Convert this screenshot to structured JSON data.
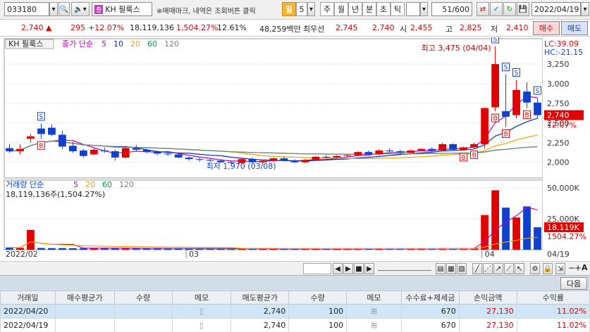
{
  "toolbar": {
    "code": "033180",
    "stock_name": "KH 필룩스",
    "notice": "※매매마크, 내역은 조회버튼 클릭",
    "period_selected": "일",
    "period_num": "5",
    "periods": [
      "주",
      "월",
      "년",
      "분",
      "초",
      "틱"
    ],
    "count": "51/600",
    "date": "2022/04/19"
  },
  "quote": {
    "price": "2,740",
    "change": "295",
    "change_pct": "+12.07%",
    "volume": "18,119,136",
    "volume_pct": "1,504.27%",
    "turnover": "12.61%",
    "amount": "48,259백만",
    "best_ask_label": "최우선",
    "best_ask": "2,745",
    "best_bid": "2,740",
    "open_label": "시",
    "open": "2,455",
    "high_label": "고",
    "high": "2,825",
    "low_label": "저",
    "low": "2,410",
    "sell_label": "매수",
    "buy_label": "매도"
  },
  "chart_data": [
    {
      "type": "candlestick",
      "name": "KH 필룩스",
      "legend": {
        "label": "종가 단순",
        "periods": [
          "5",
          "10",
          "20",
          "60",
          "120"
        ],
        "colors": [
          "#c000c0",
          "#0030c0",
          "#f0a000",
          "#00a040",
          "#808080"
        ]
      },
      "ylim": [
        1800,
        3520
      ],
      "yticks": [
        "3,250",
        "3,000",
        "2,750",
        "2,500",
        "2,250",
        "2,000"
      ],
      "ytick_values": [
        3250,
        3000,
        2750,
        2500,
        2250,
        2000
      ],
      "xlabels": [
        "2022/02",
        "03",
        "04",
        "04/19"
      ],
      "indicators": {
        "lc": "LC:39.09",
        "hc": "HC:-21.15"
      },
      "max_label": "최고 3,475 (04/04)",
      "min_label": "최저 1,970 (03/08)",
      "last_price": "2,740",
      "last_pct": "12.07%",
      "ohlc": [
        [
          2180,
          2230,
          2120,
          2140
        ],
        [
          2140,
          2230,
          2100,
          2170
        ],
        [
          2300,
          2360,
          2250,
          2330
        ],
        [
          2430,
          2490,
          2300,
          2360
        ],
        [
          2440,
          2480,
          2330,
          2350
        ],
        [
          2350,
          2400,
          2170,
          2200
        ],
        [
          2210,
          2260,
          2120,
          2140
        ],
        [
          2150,
          2170,
          2060,
          2080
        ],
        [
          2100,
          2190,
          2090,
          2160
        ],
        [
          2150,
          2190,
          2120,
          2140
        ],
        [
          2140,
          2160,
          2020,
          2060
        ],
        [
          2060,
          2200,
          2050,
          2180
        ],
        [
          2180,
          2220,
          2140,
          2160
        ],
        [
          2160,
          2170,
          2110,
          2130
        ],
        [
          2130,
          2150,
          2090,
          2110
        ],
        [
          2110,
          2130,
          2080,
          2100
        ],
        [
          2100,
          2110,
          2050,
          2060
        ],
        [
          2060,
          2070,
          2020,
          2040
        ],
        [
          2040,
          2060,
          2010,
          2030
        ],
        [
          2030,
          2050,
          2000,
          2020
        ],
        [
          2020,
          2040,
          1990,
          2000
        ],
        [
          2000,
          2020,
          1970,
          1990
        ],
        [
          1990,
          2050,
          1980,
          2040
        ],
        [
          2040,
          2060,
          1990,
          2000
        ],
        [
          2000,
          2030,
          1980,
          2020
        ],
        [
          2020,
          2060,
          2000,
          2050
        ],
        [
          2050,
          2070,
          2010,
          2020
        ],
        [
          2020,
          2040,
          1990,
          2000
        ],
        [
          2000,
          2040,
          1990,
          2030
        ],
        [
          2030,
          2080,
          2020,
          2070
        ],
        [
          2070,
          2090,
          2040,
          2060
        ],
        [
          2060,
          2090,
          2050,
          2080
        ],
        [
          2080,
          2100,
          2060,
          2090
        ],
        [
          2090,
          2140,
          2080,
          2130
        ],
        [
          2130,
          2150,
          2080,
          2100
        ],
        [
          2100,
          2170,
          2090,
          2150
        ],
        [
          2150,
          2180,
          2120,
          2140
        ],
        [
          2140,
          2160,
          2100,
          2120
        ],
        [
          2120,
          2160,
          2110,
          2150
        ],
        [
          2150,
          2180,
          2140,
          2170
        ],
        [
          2170,
          2190,
          2130,
          2150
        ],
        [
          2150,
          2250,
          2140,
          2230
        ],
        [
          2230,
          2240,
          2150,
          2160
        ],
        [
          2160,
          2200,
          2150,
          2190
        ],
        [
          2190,
          2250,
          2180,
          2230
        ],
        [
          2230,
          2700,
          2170,
          2690
        ],
        [
          2700,
          3475,
          2650,
          3250
        ],
        [
          2650,
          3120,
          2450,
          2580
        ],
        [
          2600,
          3050,
          2560,
          2920
        ],
        [
          2900,
          3020,
          2690,
          2760
        ],
        [
          2760,
          2820,
          2560,
          2600
        ]
      ],
      "markers_buy": [
        3,
        43,
        44,
        46,
        47,
        49
      ],
      "markers_sell": [
        3,
        46,
        47,
        48,
        50
      ]
    },
    {
      "type": "bar",
      "name": "거래량",
      "legend": {
        "label": "거래량 단순",
        "periods": [
          "5",
          "20",
          "60",
          "120"
        ],
        "colors": [
          "#c000c0",
          "#f0a000",
          "#00a040",
          "#808080"
        ]
      },
      "header": "18,119,136주(1,504.27%)",
      "ylim": [
        0,
        54000
      ],
      "yticks": [
        "50,000K",
        "25,000K"
      ],
      "ytick_values": [
        50000,
        25000
      ],
      "last_value": "18,119K",
      "last_pct": "1504.27%",
      "values": [
        1800,
        1500,
        16000,
        1400,
        1300,
        1300,
        1200,
        1200,
        1300,
        1100,
        1200,
        1100,
        1100,
        1000,
        1000,
        900,
        1000,
        900,
        900,
        900,
        800,
        1000,
        900,
        800,
        800,
        900,
        800,
        800,
        900,
        800,
        800,
        900,
        800,
        900,
        800,
        800,
        900,
        800,
        900,
        800,
        900,
        1200,
        1000,
        900,
        1100,
        28000,
        48000,
        34000,
        26000,
        35000,
        18119
      ]
    }
  ],
  "table": {
    "next_label": "다음",
    "headers": [
      "거래일",
      "매수평균가",
      "수량",
      "메모",
      "매도평균가",
      "수량",
      "메모",
      "수수료+제세금",
      "손익금액",
      "수익률"
    ],
    "rows": [
      [
        "2022/04/20",
        "",
        "",
        "",
        "2,740",
        "100",
        "",
        "670",
        "27,130",
        "11.02%"
      ],
      [
        "2022/04/19",
        "",
        "",
        "",
        "2,740",
        "100",
        "",
        "670",
        "27,130",
        "11.02%"
      ]
    ]
  }
}
